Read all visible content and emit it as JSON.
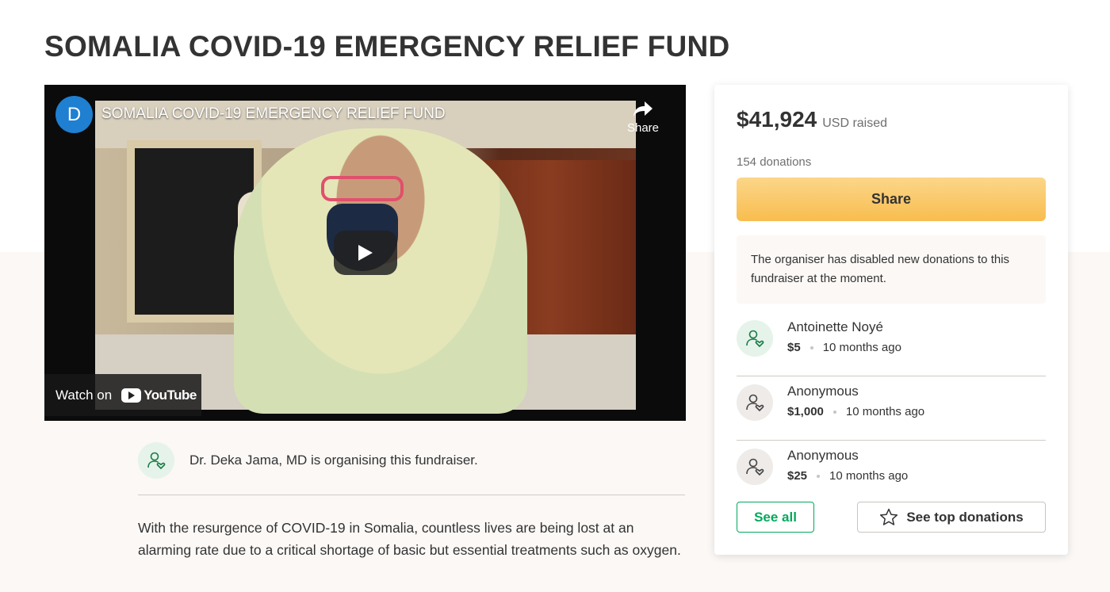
{
  "page": {
    "title": "SOMALIA COVID-19 EMERGENCY RELIEF FUND"
  },
  "video": {
    "channel_initial": "D",
    "title": "SOMALIA COVID-19 EMERGENCY RELIEF FUND",
    "share_label": "Share",
    "watch_on_label": "Watch on",
    "youtube_label": "YouTube"
  },
  "organiser": {
    "text": "Dr. Deka Jama, MD is organising this fundraiser."
  },
  "story": {
    "text": "With the resurgence of COVID-19 in Somalia, countless lives are being lost at an alarming rate due to a critical shortage of basic but essential treatments such as oxygen."
  },
  "donation_card": {
    "raised_amount": "$41,924",
    "raised_label": "USD raised",
    "donation_count": "154 donations",
    "share_button": "Share",
    "notice": "The organiser has disabled new donations to this fundraiser at the moment.",
    "donors": [
      {
        "name": "Antoinette Noyé",
        "amount": "$5",
        "time": "10 months ago"
      },
      {
        "name": "Anonymous",
        "amount": "$1,000",
        "time": "10 months ago"
      },
      {
        "name": "Anonymous",
        "amount": "$25",
        "time": "10 months ago"
      }
    ],
    "see_all_button": "See all",
    "see_top_button": "See top donations"
  },
  "colors": {
    "brand_green": "#02a95c",
    "share_yellow": "#f8bd4e",
    "text": "#333333"
  }
}
